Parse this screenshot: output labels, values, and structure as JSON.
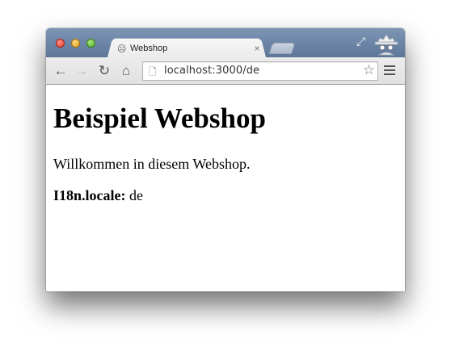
{
  "browser": {
    "tab": {
      "title": "Webshop",
      "favicon": "ghost-icon",
      "close_label": "×"
    },
    "toolbar": {
      "back_icon": "←",
      "forward_icon": "→",
      "reload_icon": "↻",
      "home_icon": "⌂",
      "url": "localhost:3000/de",
      "star_icon": "☆"
    },
    "colors": {
      "titlebar": "#6a83a6",
      "toolbar": "#e6e6e6"
    }
  },
  "page": {
    "heading": "Beispiel Webshop",
    "welcome": "Willkommen in diesem Webshop.",
    "locale_key": "I18n.locale:",
    "locale_value": "de"
  }
}
